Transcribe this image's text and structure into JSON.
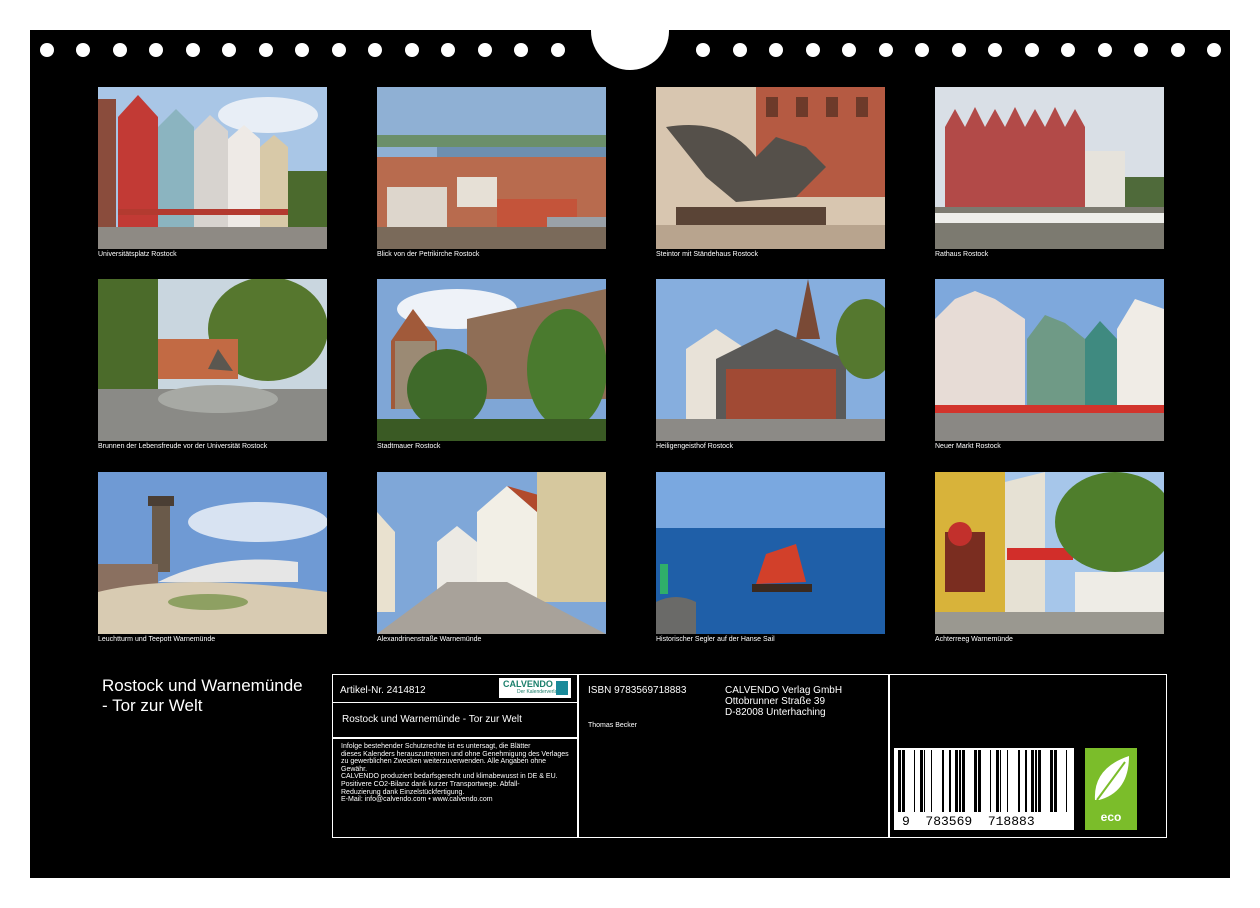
{
  "photos": [
    {
      "caption": "Universitätsplatz Rostock"
    },
    {
      "caption": "Blick von der Petrikirche Rostock"
    },
    {
      "caption": "Steintor mit Ständehaus Rostock"
    },
    {
      "caption": "Rathaus Rostock"
    },
    {
      "caption": "Brunnen der Lebensfreude vor der Universität Rostock"
    },
    {
      "caption": "Stadtmauer Rostock"
    },
    {
      "caption": "Heiligengeisthof Rostock"
    },
    {
      "caption": "Neuer Markt Rostock"
    },
    {
      "caption": "Leuchtturm und Teepott Warnemünde"
    },
    {
      "caption": "Alexandrinenstraße Warnemünde"
    },
    {
      "caption": "Historischer Segler auf der Hanse Sail"
    },
    {
      "caption": "Achterreeg Warnemünde"
    }
  ],
  "calendar": {
    "title": "Rostock und Warnemünde - Tor zur Welt",
    "article_no": "Artikel-Nr. 2414812",
    "logo_text": "CALVENDO",
    "logo_sub": "Der Kalenderverlag",
    "subtitle": "Rostock und Warnemünde - Tor zur Welt",
    "legal_lines": [
      "Infolge bestehender Schutzrechte ist es untersagt, die Blätter",
      "dieses Kalenders herauszutrennen und ohne Genehmigung des Verlages",
      "zu gewerblichen Zwecken weiterzuverwenden. Alle Angaben ohne",
      "Gewähr.",
      "CALVENDO produziert bedarfsgerecht und klimabewusst in DE & EU.",
      "Positivere CO2-Bilanz dank kurzer Transportwege. Abfall-",
      "Reduzierung dank Einzelstückfertigung.",
      "E-Mail: info@calvendo.com • www.calvendo.com"
    ],
    "isbn": "ISBN 9783569718883",
    "author": "Thomas Becker",
    "publisher_lines": [
      "CALVENDO Verlag GmbH",
      "Ottobrunner Straße 39",
      "D-82008 Unterhaching"
    ],
    "barcode_digits": "9  783569  718883",
    "eco_label": "eco"
  }
}
